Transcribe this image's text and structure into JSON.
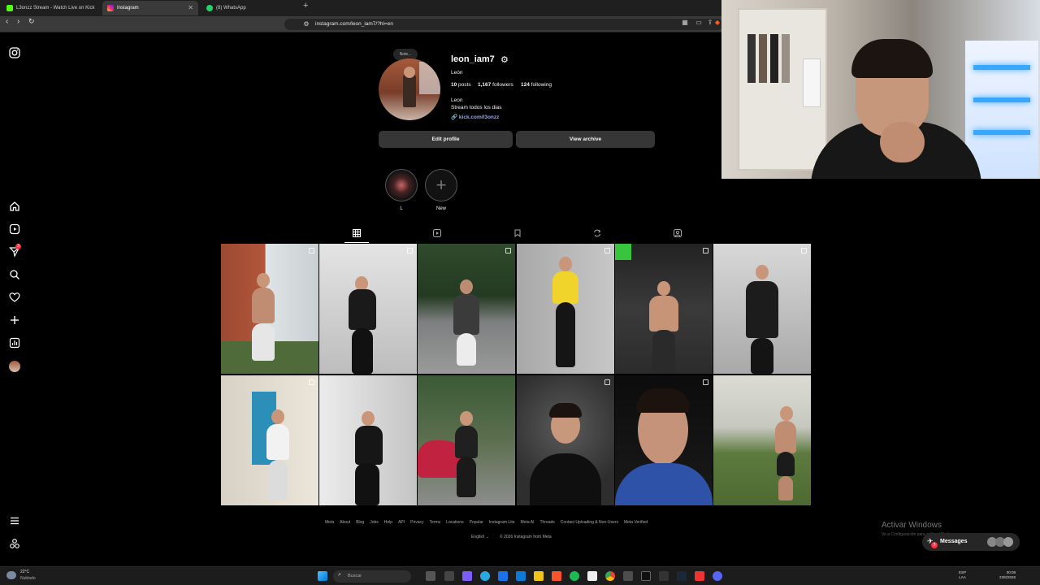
{
  "browser": {
    "tabs": [
      {
        "label": "L3onzz Stream - Watch Live on Kick",
        "active": false
      },
      {
        "label": "Instagram",
        "active": true
      },
      {
        "label": "(8) WhatsApp",
        "active": false
      }
    ],
    "url": "instagram.com/leon_iam7/?hl=en"
  },
  "profile": {
    "username": "leon_iam7",
    "display_name": "León",
    "stats": {
      "posts": "10",
      "posts_label": "posts",
      "followers": "1,167",
      "followers_label": "followers",
      "following": "124",
      "following_label": "following"
    },
    "bio_name": "Leon",
    "bio_text": "Stream todos los dias",
    "bio_link": "kick.com/l3onzz",
    "note": "Note...",
    "edit_profile_label": "Edit profile",
    "view_archive_label": "View archive"
  },
  "highlights": [
    {
      "label": "L"
    },
    {
      "label": "New"
    }
  ],
  "nav": {
    "notification_count": "3"
  },
  "footer": {
    "links": [
      "Meta",
      "About",
      "Blog",
      "Jobs",
      "Help",
      "API",
      "Privacy",
      "Terms",
      "Locations",
      "Popular",
      "Instagram Lite",
      "Meta AI",
      "Threads",
      "Contact Uploading & Non-Users",
      "Meta Verified"
    ],
    "language": "English",
    "copyright": "© 2026 Instagram from Meta"
  },
  "messages": {
    "label": "Messages",
    "badge": "3"
  },
  "watermark": {
    "title": "Activar Windows",
    "subtitle": "Ve a Configuración para activar Windows."
  },
  "taskbar": {
    "temperature": "22°C",
    "weather": "Nublado",
    "search_placeholder": "Buscar",
    "lang_line1": "ESP",
    "lang_line2": "LAA",
    "time": "00:08",
    "date": "23/8/2026"
  }
}
